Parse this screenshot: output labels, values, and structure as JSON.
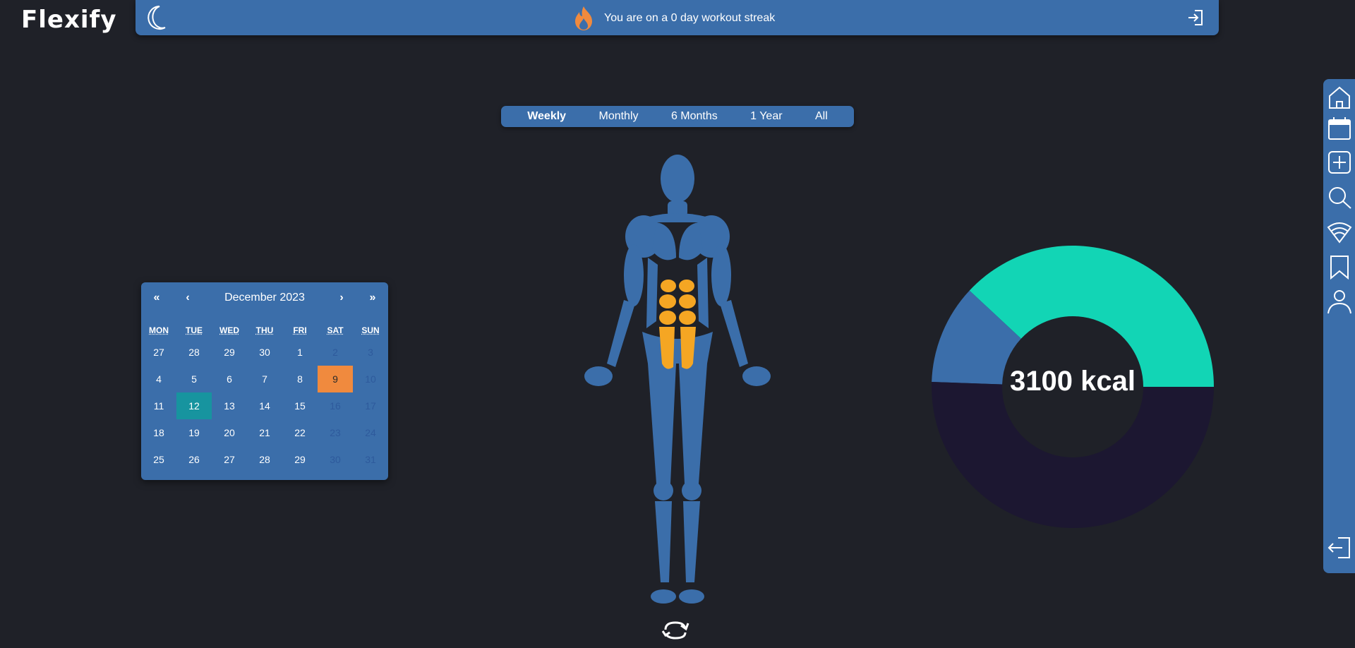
{
  "app": {
    "logo": "Flexify"
  },
  "topbar": {
    "streak_text": "You are on a 0 day workout streak"
  },
  "period_tabs": [
    "Weekly",
    "Monthly",
    "6 Months",
    "1 Year",
    "All"
  ],
  "calendar": {
    "month_label": "December 2023",
    "nav": {
      "prev_year": "«",
      "prev_month": "‹",
      "next_month": "›",
      "next_year": "»"
    },
    "weekdays": [
      "MON",
      "TUE",
      "WED",
      "THU",
      "FRI",
      "SAT",
      "SUN"
    ],
    "weeks": [
      [
        "27",
        "28",
        "29",
        "30",
        "1",
        "2",
        "3"
      ],
      [
        "4",
        "5",
        "6",
        "7",
        "8",
        "9",
        "10"
      ],
      [
        "11",
        "12",
        "13",
        "14",
        "15",
        "16",
        "17"
      ],
      [
        "18",
        "19",
        "20",
        "21",
        "22",
        "23",
        "24"
      ],
      [
        "25",
        "26",
        "27",
        "28",
        "29",
        "30",
        "31"
      ]
    ],
    "marked_day": "9",
    "today": "12"
  },
  "calories": {
    "label": "3100 kcal",
    "colors": {
      "teal": "#12d5b5",
      "blue": "#3b6eaa",
      "dark": "#1c1731"
    }
  },
  "colors": {
    "accent": "#3b6eaa",
    "flame": "#f08a3e",
    "highlight_muscle": "#f5a623"
  },
  "sidenav": [
    "home-icon",
    "calendar-icon",
    "add-icon",
    "search-icon",
    "wifi-icon",
    "bookmark-icon",
    "user-icon",
    "logout-icon"
  ]
}
